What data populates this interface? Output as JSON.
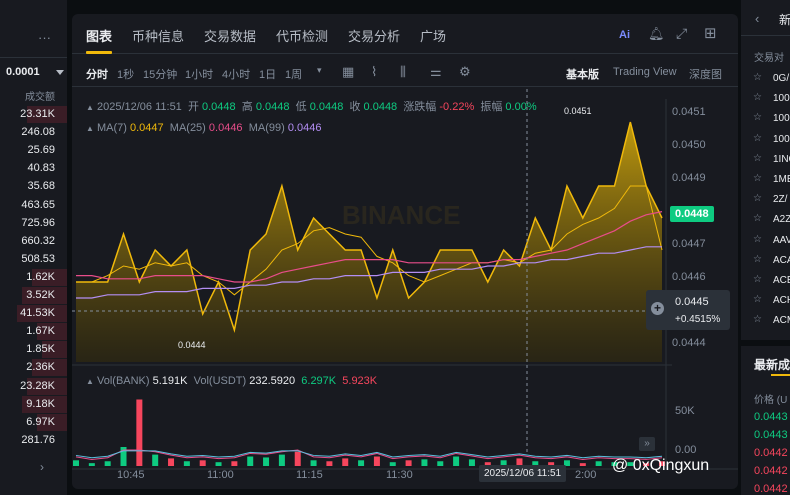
{
  "left_panel": {
    "top_value": "0.0001",
    "col_header": "成交额",
    "values": [
      "23.31K",
      "246.08",
      "25.69",
      "40.83",
      "35.68",
      "463.65",
      "725.96",
      "660.32",
      "508.53",
      "1.62K",
      "3.52K",
      "41.53K",
      "1.67K",
      "1.85K",
      "2.36K",
      "23.28K",
      "9.18K",
      "6.97K",
      "281.76"
    ]
  },
  "tabs": [
    "图表",
    "币种信息",
    "交易数据",
    "代币检测",
    "交易分析",
    "广场"
  ],
  "toolbar": {
    "intervals": [
      "分时",
      "1秒",
      "15分钟",
      "1小时",
      "4小时",
      "1日",
      "1周"
    ],
    "views": [
      "基本版",
      "Trading View",
      "深度图"
    ]
  },
  "ohlc": {
    "datetime": "2025/12/06 11:51",
    "open_label": "开",
    "open": "0.0448",
    "high_label": "高",
    "high": "0.0448",
    "low_label": "低",
    "low": "0.0448",
    "close_label": "收",
    "close": "0.0448",
    "change_label": "涨跌幅",
    "change": "-0.22%",
    "amp_label": "振幅",
    "amp": "0.00%"
  },
  "ma": {
    "ma7_label": "MA(7)",
    "ma7": "0.0447",
    "ma25_label": "MA(25)",
    "ma25": "0.0446",
    "ma99_label": "MA(99)",
    "ma99": "0.0446"
  },
  "vol": {
    "bank_label": "Vol(BANK)",
    "bank": "5.191K",
    "usdt_label": "Vol(USDT)",
    "usdt": "232.5920",
    "v1": "6.297K",
    "v2": "5.923K"
  },
  "price_axis": [
    "0.0451",
    "0.0450",
    "0.0449",
    "0.0448",
    "0.0447",
    "0.0446",
    "0.0445",
    "0.0444"
  ],
  "vol_axis": [
    "50K",
    "0.00"
  ],
  "time_axis": [
    "10:45",
    "11:00",
    "11:15",
    "11:30"
  ],
  "time_tail": "2:00",
  "cursor_time": "2025/12/06 11:51",
  "current_price": "0.0448",
  "cursor_price": "0.0445",
  "cursor_pct": "+0.4515%",
  "high_mark": "0.0451",
  "low_mark": "0.0444",
  "watermark": "BINANCE",
  "brand": "@ 0xQingxun",
  "right_panel": {
    "header": "交易对",
    "list": [
      "0G/",
      "100",
      "100",
      "100",
      "1INC",
      "1ME",
      "2Z/",
      "A2Z",
      "AAV",
      "ACA",
      "ACE",
      "ACH",
      "ACM"
    ],
    "section": "最新成",
    "price_header": "价格 (U",
    "prices": [
      "0.0443",
      "0.0443",
      "0.0442",
      "0.0442",
      "0.0442"
    ]
  },
  "chart_data": {
    "type": "area",
    "x": [
      "10:37",
      "10:39",
      "10:41",
      "10:43",
      "10:45",
      "10:47",
      "10:49",
      "10:51",
      "10:53",
      "10:55",
      "10:57",
      "10:59",
      "11:01",
      "11:03",
      "11:05",
      "11:07",
      "11:09",
      "11:11",
      "11:13",
      "11:15",
      "11:17",
      "11:19",
      "11:21",
      "11:23",
      "11:25",
      "11:27",
      "11:29",
      "11:31",
      "11:33",
      "11:35",
      "11:37",
      "11:39",
      "11:41",
      "11:43",
      "11:45",
      "11:47",
      "11:49",
      "11:51"
    ],
    "series": [
      {
        "name": "price",
        "values": [
          0.0446,
          0.0446,
          0.0446,
          0.04475,
          0.0446,
          0.0447,
          0.04465,
          0.0447,
          0.0445,
          0.0446,
          0.04445,
          0.0447,
          0.04475,
          0.0449,
          0.0447,
          0.0448,
          0.04475,
          0.0447,
          0.0447,
          0.04455,
          0.0447,
          0.04455,
          0.0446,
          0.0447,
          0.0447,
          0.0447,
          0.0446,
          0.0447,
          0.04465,
          0.0448,
          0.0447,
          0.0449,
          0.0448,
          0.0449,
          0.0449,
          0.0451,
          0.0449,
          0.0448
        ]
      },
      {
        "name": "MA(7)",
        "values": [
          0.0446,
          0.0446,
          0.04462,
          0.04465,
          0.04464,
          0.04466,
          0.04465,
          0.04466,
          0.04462,
          0.0446,
          0.04456,
          0.0446,
          0.04464,
          0.0447,
          0.04472,
          0.04476,
          0.04477,
          0.04475,
          0.04474,
          0.04468,
          0.04466,
          0.04462,
          0.0446,
          0.04462,
          0.04464,
          0.04466,
          0.04466,
          0.04467,
          0.04466,
          0.04469,
          0.0447,
          0.04475,
          0.04478,
          0.0448,
          0.04483,
          0.0449,
          0.0449,
          0.0447
        ]
      },
      {
        "name": "MA(25)",
        "values": [
          0.04462,
          0.04462,
          0.04461,
          0.04461,
          0.04461,
          0.04462,
          0.04462,
          0.04462,
          0.04462,
          0.04461,
          0.0446,
          0.0446,
          0.04461,
          0.04463,
          0.04464,
          0.04465,
          0.04466,
          0.04467,
          0.04467,
          0.04467,
          0.04467,
          0.04466,
          0.04466,
          0.04466,
          0.04466,
          0.04466,
          0.04466,
          0.04467,
          0.04467,
          0.04468,
          0.04469,
          0.0447,
          0.04472,
          0.04474,
          0.04476,
          0.04479,
          0.04481,
          0.04482
        ]
      },
      {
        "name": "MA(99)",
        "values": [
          0.04455,
          0.04455,
          0.04456,
          0.04456,
          0.04456,
          0.04457,
          0.04457,
          0.04457,
          0.04458,
          0.04458,
          0.04458,
          0.04459,
          0.04459,
          0.0446,
          0.0446,
          0.04461,
          0.04461,
          0.04462,
          0.04462,
          0.04462,
          0.04463,
          0.04463,
          0.04463,
          0.04464,
          0.04464,
          0.04464,
          0.04465,
          0.04465,
          0.04466,
          0.04466,
          0.04467,
          0.04467,
          0.04468,
          0.04469,
          0.04469,
          0.0447,
          0.04471,
          0.04471
        ]
      },
      {
        "name": "volume",
        "values": [
          6,
          3,
          5,
          20,
          70,
          12,
          8,
          5,
          6,
          4,
          5,
          10,
          9,
          12,
          15,
          6,
          5,
          8,
          6,
          10,
          4,
          6,
          7,
          5,
          10,
          7,
          4,
          6,
          8,
          5,
          4,
          6,
          3,
          5,
          4,
          4,
          3,
          5
        ]
      }
    ],
    "ylim": [
      0.04435,
      0.04515
    ],
    "vol_ylim": [
      0,
      80
    ]
  }
}
